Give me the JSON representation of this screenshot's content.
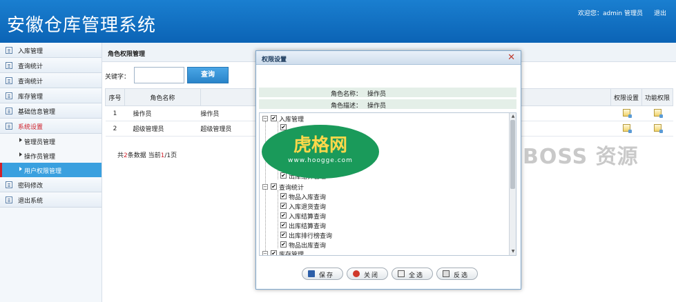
{
  "app": {
    "title": "安徽仓库管理系统",
    "welcome": "欢迎您：admin 管理员",
    "logout": "退出"
  },
  "sidebar": {
    "items": [
      {
        "label": "入库管理"
      },
      {
        "label": "查询统计"
      },
      {
        "label": "查询统计"
      },
      {
        "label": "库存管理"
      },
      {
        "label": "基础信息管理"
      },
      {
        "label": "系统设置"
      }
    ],
    "submenu": [
      {
        "label": "管理员管理"
      },
      {
        "label": "操作员管理"
      },
      {
        "label": "用户权限管理"
      }
    ],
    "bottom_items": [
      {
        "label": "密码修改"
      },
      {
        "label": "退出系统"
      }
    ]
  },
  "main": {
    "page_title": "角色权限管理",
    "keyword_label": "关键字：",
    "search_label": "查询",
    "columns": [
      "序号",
      "角色名称",
      "权限设置",
      "功能权限"
    ],
    "rows": [
      {
        "index": "1",
        "name": "操作员",
        "desc": "操作员"
      },
      {
        "index": "2",
        "name": "超级管理员",
        "desc": "超级管理员"
      }
    ],
    "pager": {
      "prefix": "共",
      "total": "2",
      "middle": "条数据 当前",
      "current": "1",
      "slash": "/",
      "pages": "1",
      "suffix": "页"
    }
  },
  "dialog": {
    "title": "权限设置",
    "role_name_label": "角色名称：",
    "role_name_value": "操作员",
    "role_desc_label": "角色描述：",
    "role_desc_value": "操作员",
    "tree": {
      "g1": "入库管理",
      "g1_partial": "出库结算管理",
      "g2": "查询统计",
      "g2_children": [
        "物品入库查询",
        "入库退货查询",
        "入库结算查询",
        "出库结算查询",
        "出库排行榜查询",
        "物品出库查询"
      ],
      "g3": "库存管理"
    },
    "buttons": {
      "save": "保存",
      "close": "关闭",
      "select_all": "全选",
      "invert": "反选"
    }
  },
  "watermarks": {
    "oval_text": "虎格网",
    "oval_url": "www.hoogge.com",
    "boss": "BOSS 资源"
  }
}
